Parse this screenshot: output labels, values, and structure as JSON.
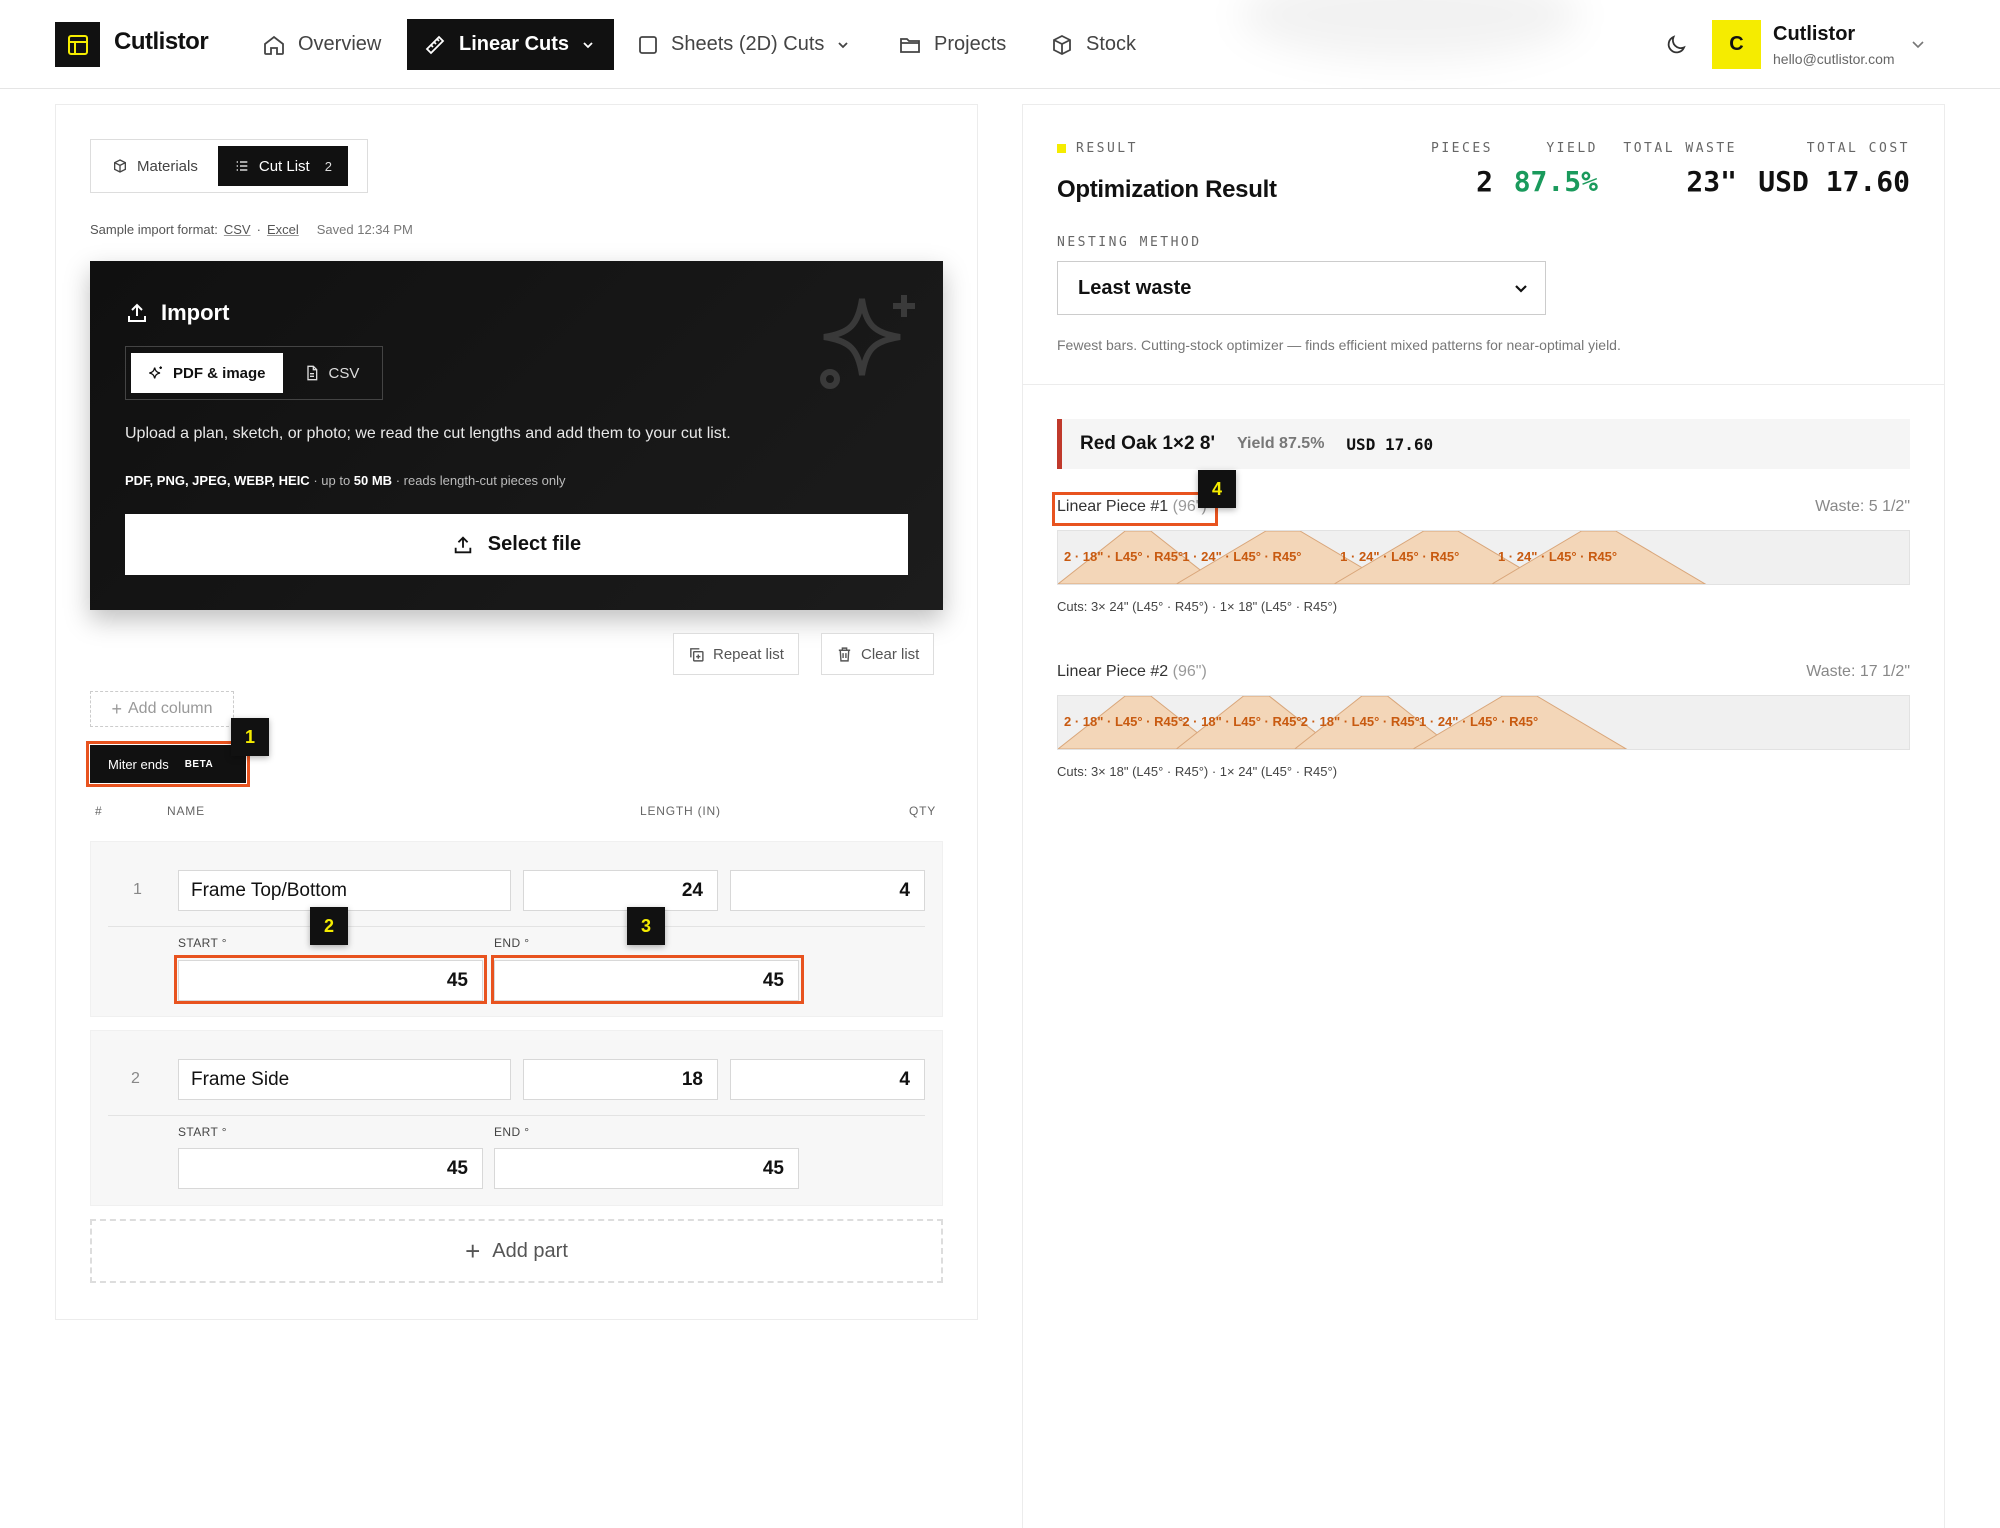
{
  "app": {
    "name": "Cutlistor"
  },
  "nav": {
    "overview": "Overview",
    "linear_cuts": "Linear Cuts",
    "sheets": "Sheets (2D) Cuts",
    "projects": "Projects",
    "stock": "Stock"
  },
  "user": {
    "initial": "C",
    "name": "Cutlistor",
    "email": "hello@cutlistor.com"
  },
  "left": {
    "tabs": {
      "materials": "Materials",
      "cut_list": "Cut List",
      "cut_list_count": "2"
    },
    "import_format": {
      "label": "Sample import format:",
      "csv": "CSV",
      "sep": "·",
      "excel": "Excel",
      "saved": "Saved 12:34 PM"
    },
    "import": {
      "title": "Import",
      "tab_pdf": "PDF & image",
      "tab_csv": "CSV",
      "description": "Upload a plan, sketch, or photo; we read the cut lengths and add them to your cut list.",
      "formats_bold": "PDF, PNG, JPEG, WEBP, HEIC",
      "formats_mid": " · up to ",
      "formats_size": "50 MB",
      "formats_tail": " · reads length-cut pieces only",
      "select_file": "Select file"
    },
    "repeat_list": "Repeat list",
    "clear_list": "Clear list",
    "add_column": "Add column",
    "miter": {
      "label": "Miter ends",
      "badge": "BETA"
    },
    "columns": {
      "num": "#",
      "name": "NAME",
      "length": "LENGTH (IN)",
      "qty": "QTY"
    },
    "parts": [
      {
        "num": "1",
        "name": "Frame Top/Bottom",
        "length": "24",
        "qty": "4",
        "start_label": "START °",
        "end_label": "END °",
        "start": "45",
        "end": "45"
      },
      {
        "num": "2",
        "name": "Frame Side",
        "length": "18",
        "qty": "4",
        "start_label": "START °",
        "end_label": "END °",
        "start": "45",
        "end": "45"
      }
    ],
    "add_part": "Add part"
  },
  "markers": [
    "1",
    "2",
    "3",
    "4"
  ],
  "result": {
    "tag": "RESULT",
    "title": "Optimization Result",
    "stats": {
      "pieces_label": "PIECES",
      "pieces": "2",
      "yield_label": "YIELD",
      "yield": "87.5%",
      "waste_label": "TOTAL WASTE",
      "waste": "23\"",
      "cost_label": "TOTAL COST",
      "cost": "USD 17.60"
    },
    "nesting": {
      "label": "NESTING METHOD",
      "selected": "Least waste",
      "help": "Fewest bars. Cutting-stock optimizer — finds efficient mixed patterns for near-optimal yield."
    },
    "stock": {
      "name": "Red Oak 1×2 8'",
      "yield": "Yield 87.5%",
      "cost": "USD 17.60"
    },
    "pieces": [
      {
        "title": "Linear Piece #1",
        "length": "(96\")",
        "waste": "Waste: 5 1/2\"",
        "cuts": [
          {
            "label": "2 · 18\" · L45° · R45°",
            "len": 18
          },
          {
            "label": "1 · 24\" · L45° · R45°",
            "len": 24
          },
          {
            "label": "1 · 24\" · L45° · R45°",
            "len": 24
          },
          {
            "label": "1 · 24\" · L45° · R45°",
            "len": 24
          }
        ],
        "summary": "Cuts: 3× 24\" (L45° · R45°) · 1× 18\" (L45° · R45°)"
      },
      {
        "title": "Linear Piece #2",
        "length": "(96\")",
        "waste": "Waste: 17 1/2\"",
        "cuts": [
          {
            "label": "2 · 18\" · L45° · R45°",
            "len": 18
          },
          {
            "label": "2 · 18\" · L45° · R45°",
            "len": 18
          },
          {
            "label": "2 · 18\" · L45° · R45°",
            "len": 18
          },
          {
            "label": "1 · 24\" · L45° · R45°",
            "len": 24
          }
        ],
        "summary": "Cuts: 3× 18\" (L45° · R45°) · 1× 24\" (L45° · R45°)"
      }
    ]
  },
  "colors": {
    "accent": "#f5ec00",
    "highlight": "#e8531f",
    "yield_green": "#1a9a5c",
    "stock_red": "#c0392b",
    "cut_fill": "#f3d6b8",
    "cut_stroke": "#d9a67a",
    "cut_text": "#c85a10"
  }
}
